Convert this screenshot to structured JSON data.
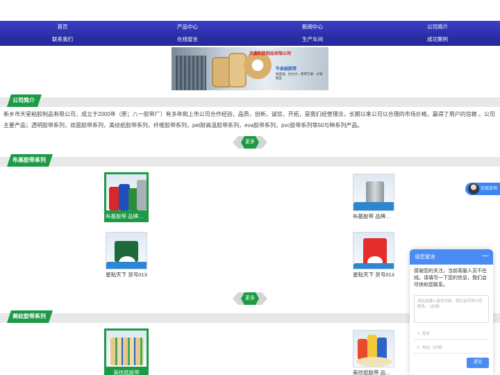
{
  "nav": {
    "row1": [
      "首页",
      "产品中心",
      "新闻中心",
      "公司简介"
    ],
    "row2": [
      "联系我们",
      "在线留言",
      "生产车间",
      "成功案例"
    ]
  },
  "banner": {
    "brand": "天鑫粘胶制品有限公司",
    "product": "牛皮纸胶带",
    "tagline": "粘度强、拉力大、便用方便、价格便宜"
  },
  "sections": {
    "about": "公司简介",
    "cloth_tape": "布基胶带系列",
    "masking_tape": "美纹胶带系列"
  },
  "about_text": "新乡市天星粘胶制品有限公司，成立于2000年（原；八一胶带厂）有多年和上市公司合作经验，品质，创新，诚信，开拓，是我们经营理念，长期以来公司以合理的市场价格，赢得了用户的信赖 。公司主要产品；透明胶带系列，双面胶带系列，美纹纸胶带系列，纤维胶带系列，pet耐高温胶带系列，eva胶带系列，pvc胶带系列等50与种系列产品。",
  "more_label": "更多",
  "cloth_products": [
    {
      "caption": "布基胶带  品牌：星粘天下"
    },
    {
      "caption": "布基胶带  品牌：星粘天下"
    },
    {
      "caption": "星粘天下 货号013"
    },
    {
      "caption": "星粘天下 货号013"
    }
  ],
  "masking_products": [
    {
      "caption": "美纹纸胶带"
    },
    {
      "caption": "美纹纸胶带  品牌：星粘天下"
    }
  ],
  "float_consult": "在线咨询",
  "message": {
    "title": "请您留言",
    "minimize": "—",
    "intro": "感谢您的关注，当前客服人员不在线。请填写一下您的信息，我们会尽快和您联系。",
    "content_placeholder": "请在此输入留言内容，我们会尽快与您联系。（必填）",
    "name_placeholder": "姓名",
    "phone_placeholder": "电话（必填）",
    "submit": "提交"
  },
  "colors": {
    "nav": "#2a2fa8",
    "accent": "#1d9a45",
    "chat": "#4a8cf4"
  }
}
